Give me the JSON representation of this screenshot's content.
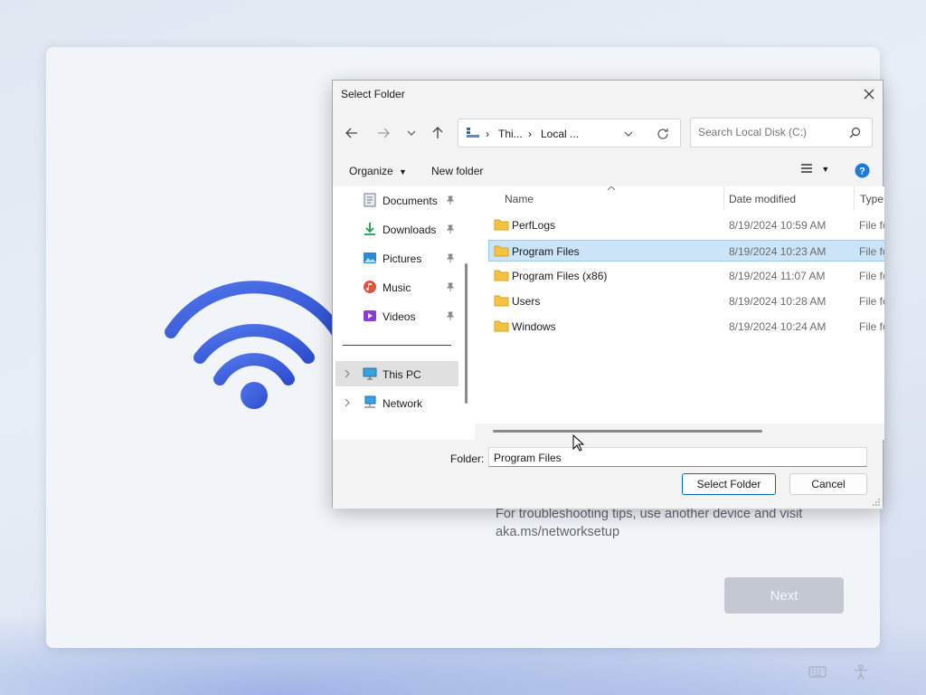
{
  "setup": {
    "help_text_line1": "For troubleshooting tips, use another device and visit",
    "help_text_line2": "aka.ms/networksetup",
    "next_label": "Next",
    "accent_color": "#3a5fd9"
  },
  "dialog": {
    "title": "Select Folder",
    "address": {
      "segments": [
        "Thi...",
        "Local ..."
      ]
    },
    "search_placeholder": "Search Local Disk (C:)",
    "toolbar": {
      "organize_label": "Organize",
      "new_folder_label": "New folder"
    },
    "nav_items": [
      {
        "label": "Documents",
        "icon": "documents-icon",
        "pinned": true
      },
      {
        "label": "Downloads",
        "icon": "downloads-icon",
        "pinned": true
      },
      {
        "label": "Pictures",
        "icon": "pictures-icon",
        "pinned": true
      },
      {
        "label": "Music",
        "icon": "music-icon",
        "pinned": true
      },
      {
        "label": "Videos",
        "icon": "videos-icon",
        "pinned": true
      },
      {
        "label": "This PC",
        "icon": "this-pc-icon",
        "selected": true
      },
      {
        "label": "Network",
        "icon": "network-icon"
      }
    ],
    "columns": {
      "name": "Name",
      "date": "Date modified",
      "type": "Type"
    },
    "files": [
      {
        "name": "PerfLogs",
        "date": "8/19/2024 10:59 AM",
        "type": "File fo"
      },
      {
        "name": "Program Files",
        "date": "8/19/2024 10:23 AM",
        "type": "File fo",
        "selected": true
      },
      {
        "name": "Program Files (x86)",
        "date": "8/19/2024 11:07 AM",
        "type": "File fo"
      },
      {
        "name": "Users",
        "date": "8/19/2024 10:28 AM",
        "type": "File fo"
      },
      {
        "name": "Windows",
        "date": "8/19/2024 10:24 AM",
        "type": "File fo"
      }
    ],
    "folder_label": "Folder:",
    "folder_value": "Program Files",
    "select_label": "Select Folder",
    "cancel_label": "Cancel"
  }
}
